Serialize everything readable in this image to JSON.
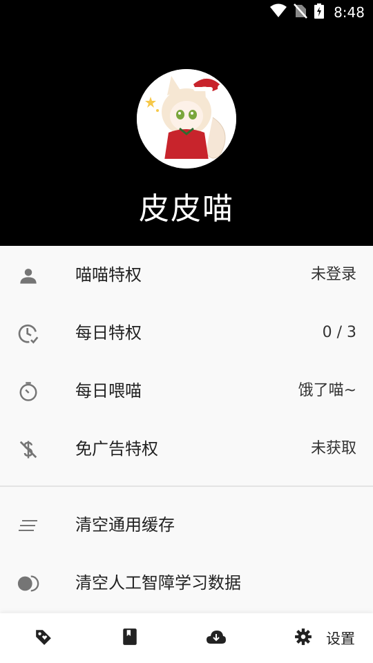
{
  "status_bar": {
    "time": "8:48",
    "icons": [
      "wifi-icon",
      "no-sim-icon",
      "battery-charging-icon"
    ]
  },
  "profile": {
    "username": "皮皮喵",
    "avatar": "anime-cat-girl-avatar"
  },
  "privileges": [
    {
      "icon": "person-icon",
      "label": "喵喵特权",
      "value": "未登录"
    },
    {
      "icon": "clock-check-icon",
      "label": "每日特权",
      "value": "0 / 3"
    },
    {
      "icon": "timer-icon",
      "label": "每日喂喵",
      "value": "饿了喵~"
    },
    {
      "icon": "no-money-icon",
      "label": "免广告特权",
      "value": "未获取"
    }
  ],
  "actions": [
    {
      "icon": "clear-lines-icon",
      "label": "清空通用缓存"
    },
    {
      "icon": "toggle-icon",
      "label": "清空人工智障学习数据"
    }
  ],
  "bottom_nav": {
    "tabs": [
      "tag-icon",
      "book-icon",
      "cloud-download-icon",
      "gear-icon"
    ],
    "settings_label": "设置"
  },
  "colors": {
    "header_bg": "#000000",
    "menu_bg": "#f9f9f9",
    "icon_gray": "#757575"
  }
}
